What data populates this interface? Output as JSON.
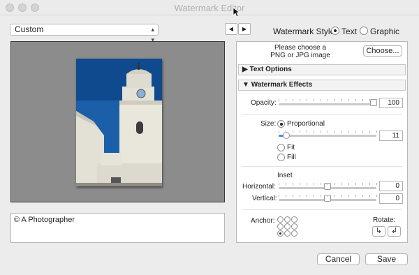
{
  "window": {
    "title": "Watermark Editor"
  },
  "preset": {
    "value": "Custom"
  },
  "nav": {
    "prev": "◀",
    "next": "▶"
  },
  "style": {
    "label": "Watermark Style:",
    "text_option": "Text",
    "graphic_option": "Graphic",
    "selected": "Text"
  },
  "image_chooser": {
    "prompt_line1": "Please choose a",
    "prompt_line2": "PNG or JPG image",
    "choose_label": "Choose..."
  },
  "text_options": {
    "label": "Text Options"
  },
  "effects": {
    "label": "Watermark Effects",
    "opacity": {
      "label": "Opacity:",
      "value": "100",
      "fraction": 1.0
    },
    "size": {
      "label": "Size:",
      "proportional": "Proportional",
      "fit": "Fit",
      "fill": "Fill",
      "selected": "Proportional",
      "value": "11",
      "fraction": 0.05
    },
    "inset": {
      "label": "Inset",
      "horizontal_label": "Horizontal:",
      "horizontal_value": "0",
      "vertical_label": "Vertical:",
      "vertical_value": "0"
    },
    "anchor": {
      "label": "Anchor:",
      "selected": "bottom-left"
    },
    "rotate": {
      "label": "Rotate:"
    }
  },
  "watermark_text": "© A Photographer",
  "footer": {
    "cancel": "Cancel",
    "save": "Save"
  }
}
